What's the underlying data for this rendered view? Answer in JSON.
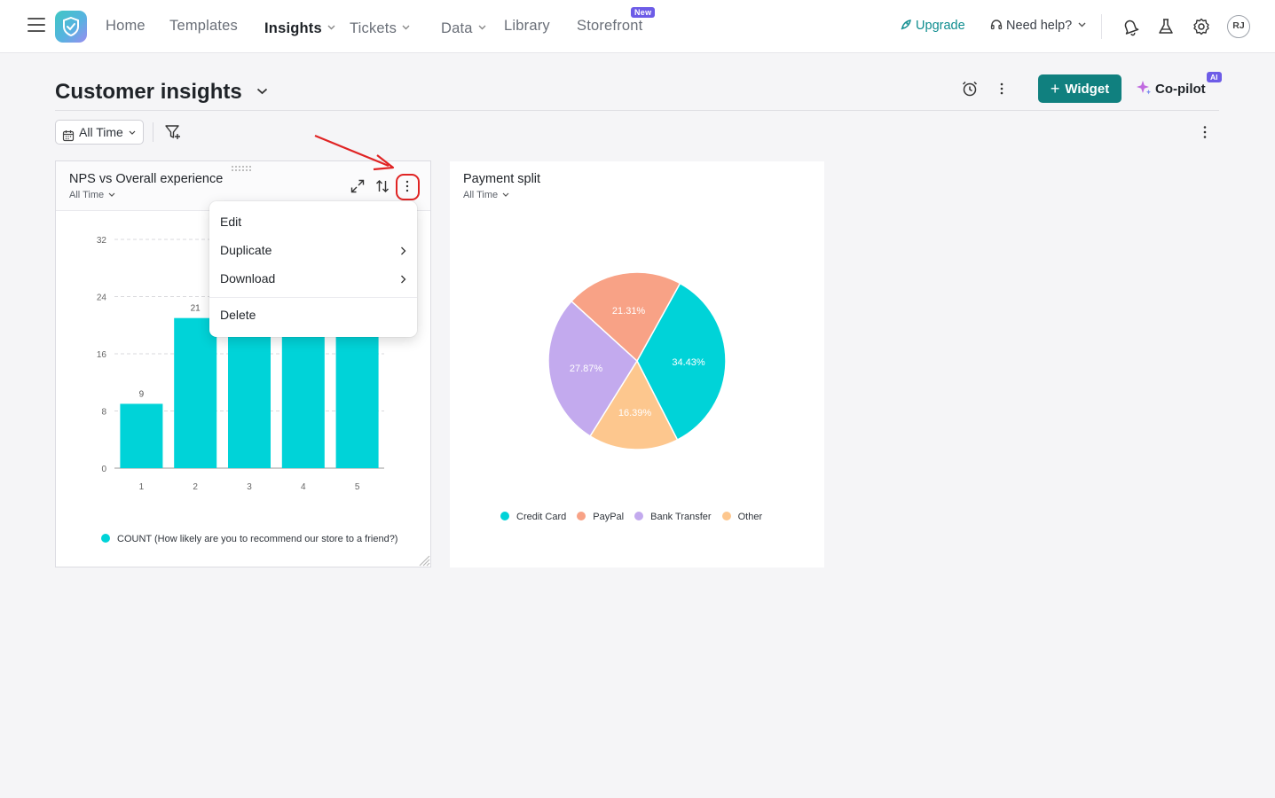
{
  "nav": {
    "items": [
      {
        "label": "Home",
        "active": false,
        "caret": false
      },
      {
        "label": "Templates",
        "active": false,
        "caret": false
      },
      {
        "label": "Insights",
        "active": true,
        "caret": true
      },
      {
        "label": "Tickets",
        "active": false,
        "caret": true
      },
      {
        "label": "Data",
        "active": false,
        "caret": true
      },
      {
        "label": "Library",
        "active": false,
        "caret": false
      },
      {
        "label": "Storefront",
        "active": false,
        "caret": false
      }
    ],
    "new_badge": "New",
    "upgrade": "Upgrade",
    "need_help": "Need help?",
    "avatar_initials": "RJ",
    "icons": [
      "bell-icon",
      "flask-icon",
      "gear-icon"
    ]
  },
  "page": {
    "title": "Customer insights",
    "widget_button": "Widget",
    "copilot": "Co-pilot",
    "ai_badge": "AI",
    "time_filter": "All Time"
  },
  "colors": {
    "accent": "#10807f",
    "badge": "#6d5ce7",
    "annotation": "#e02424"
  },
  "widgets": [
    {
      "title": "NPS vs Overall experience",
      "subtitle": "All Time",
      "legend": "COUNT (How likely are you to recommend our store to a friend?)"
    },
    {
      "title": "Payment split",
      "subtitle": "All Time"
    }
  ],
  "menu": {
    "items": [
      {
        "label": "Edit",
        "submenu": false
      },
      {
        "label": "Duplicate",
        "submenu": true
      },
      {
        "label": "Download",
        "submenu": true
      },
      {
        "label": "Delete",
        "submenu": false
      }
    ]
  },
  "chart_data": [
    {
      "type": "bar",
      "categories": [
        "1",
        "2",
        "3",
        "4",
        "5"
      ],
      "values": [
        9,
        21,
        null,
        null,
        null
      ],
      "yticks": [
        "0",
        "8",
        "16",
        "24",
        "32"
      ],
      "ylim": [
        0,
        32
      ],
      "grid": true,
      "legend_position": "bottom",
      "color": "#00d3d8",
      "series": [
        {
          "name": "COUNT (How likely are you to recommend our store to a friend?)"
        }
      ]
    },
    {
      "type": "pie",
      "categories": [
        "Credit Card",
        "PayPal",
        "Bank Transfer",
        "Other"
      ],
      "values": [
        34.43,
        21.31,
        27.87,
        16.39
      ],
      "labels": [
        "34.43%",
        "21.31%",
        "27.87%",
        "16.39%"
      ],
      "colors": [
        "#00d3d8",
        "#f8a286",
        "#c3aaee",
        "#fdc78e"
      ],
      "legend_position": "bottom"
    }
  ]
}
